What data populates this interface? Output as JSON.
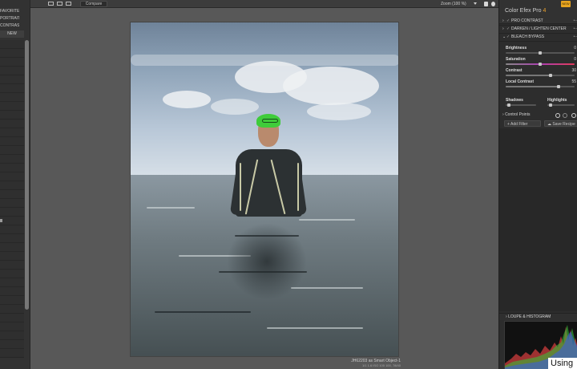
{
  "toolbar": {
    "compare_label": "Compare",
    "zoom_label": "Zoom (100 %)"
  },
  "left_panel": {
    "items": [
      "FAVORITES",
      "PORTRAIT",
      "CONTRAST"
    ],
    "new_label": "NEW"
  },
  "photo": {
    "caption_title": "JH62203 as Smart Object-1",
    "caption_detail": "1/1 1.6 ISO 100 100, 78/40"
  },
  "right_panel": {
    "title": "Color Efex Pro",
    "title_version": "4",
    "badge": "NEW",
    "filters": [
      {
        "label": "PRO CONTRAST",
        "checked": true
      },
      {
        "label": "DARKEN / LIGHTEN CENTER",
        "checked": true
      },
      {
        "label": "BLEACH BYPASS",
        "checked": true
      }
    ],
    "controls": {
      "brightness": {
        "label": "Brightness",
        "value": "0"
      },
      "saturation": {
        "label": "Saturation",
        "value": "0"
      },
      "contrast": {
        "label": "Contrast",
        "value": "30"
      },
      "local_contrast": {
        "label": "Local Contrast",
        "value": "55"
      },
      "shadows": {
        "label": "Shadows"
      },
      "highlights": {
        "label": "Highlights"
      }
    },
    "control_points_label": "Control Points",
    "add_filter_label": "Add Filter",
    "save_recipe_label": "Save Recipe",
    "loupe_label": "LOUPE & HISTOGRAM"
  },
  "overlay_text": "Using",
  "colors": {
    "accent": "#f1a52d",
    "cap_green": "#3fcc3a"
  },
  "icons": [
    "single-view-icon",
    "split-view-icon",
    "side-by-side-icon",
    "zoom-dropdown-icon",
    "pin-icon",
    "help-icon",
    "control-point-add-icon",
    "filter-menu-icon"
  ]
}
